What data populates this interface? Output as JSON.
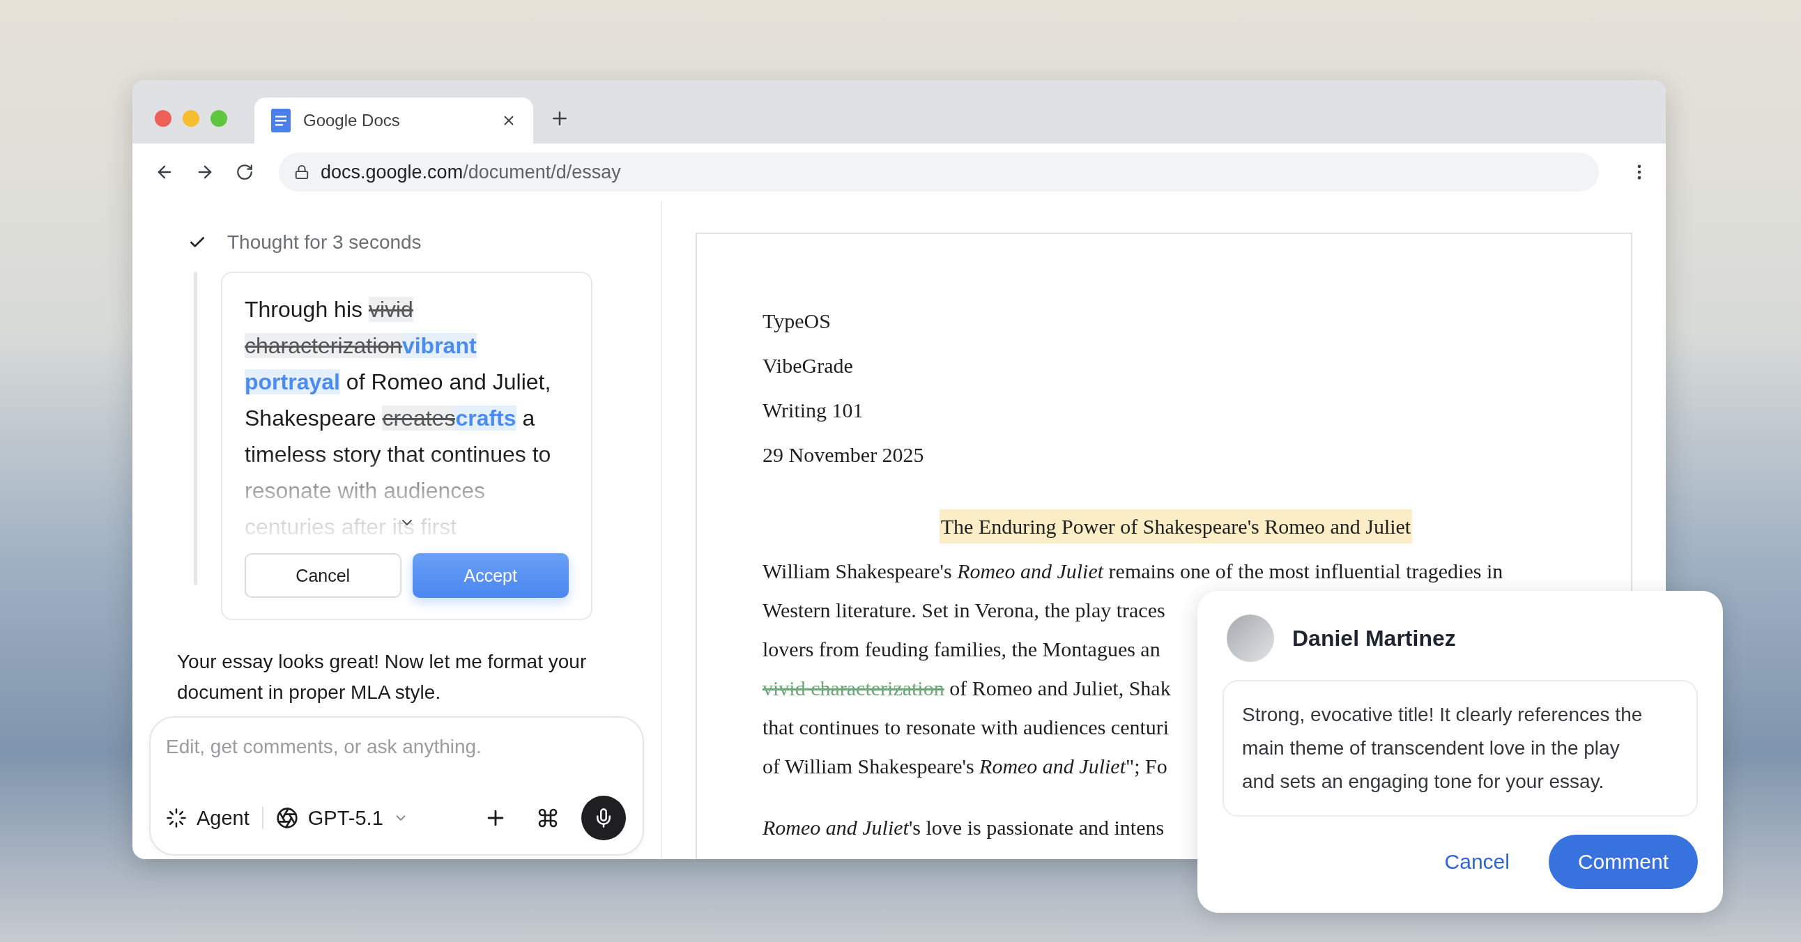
{
  "browser": {
    "tab": {
      "title": "Google Docs"
    },
    "address": {
      "host": "docs.google.com",
      "path": "/document/d/essay"
    }
  },
  "assistant": {
    "thought": "Thought for 3 seconds",
    "suggestion": {
      "segments": [
        {
          "kind": "plain",
          "text": "Through his "
        },
        {
          "kind": "deleted",
          "text": "vivid characterization"
        },
        {
          "kind": "inserted",
          "text": "vibrant portrayal"
        },
        {
          "kind": "plain",
          "text": " of Romeo and Juliet, Shakespeare "
        },
        {
          "kind": "deleted",
          "text": "creates"
        },
        {
          "kind": "inserted",
          "text": "crafts"
        },
        {
          "kind": "plain",
          "text": " a timeless story that continues to resonate with audiences centuries after its first"
        }
      ],
      "buttons": [
        {
          "kind": "secondary",
          "label": "Cancel"
        },
        {
          "kind": "primary",
          "label": "Accept"
        }
      ]
    },
    "message": "Your essay looks great! Now let me format your document in proper MLA style.",
    "composer": {
      "placeholder": "Edit, get comments, or ask anything.",
      "mode": "Agent",
      "model": "GPT-5.1"
    }
  },
  "document": {
    "header_lines": [
      "TypeOS",
      "VibeGrade",
      "Writing 101",
      "29 November 2025"
    ],
    "title": {
      "text": "The Enduring Power of Shakespeare's Romeo and Juliet",
      "highlighted": true
    },
    "paragraphs": [
      {
        "lines": [
          {
            "segments": [
              {
                "kind": "plain",
                "text": "William Shakespeare's *Romeo and Juliet* remains one of the most influential tragedies in"
              }
            ]
          },
          {
            "segments": [
              {
                "kind": "plain",
                "text": "Western literature. Set in Verona, the play traces"
              }
            ]
          },
          {
            "segments": [
              {
                "kind": "plain",
                "text": "lovers from feuding families, the Montagues an"
              }
            ]
          },
          {
            "segments": [
              {
                "kind": "deleted",
                "text": "vivid characterization"
              },
              {
                "kind": "plain",
                "text": " of Romeo and Juliet, Shak"
              }
            ]
          },
          {
            "segments": [
              {
                "kind": "plain",
                "text": "that continues to resonate with audiences centuri"
              }
            ]
          },
          {
            "segments": [
              {
                "kind": "plain",
                "text": "of William Shakespeare's *Romeo and Juliet*\"; Fo"
              }
            ]
          }
        ]
      },
      {
        "lines": [
          {
            "segments": [
              {
                "kind": "plain",
                "text": "*Romeo and Juliet*'s love is passionate and intens"
              }
            ]
          }
        ]
      }
    ]
  },
  "comment": {
    "author": "Daniel Martinez",
    "text": "Strong, evocative title! It clearly references the main theme of transcendent love in the play and sets an engaging tone for your essay.",
    "buttons": [
      {
        "kind": "secondary",
        "label": "Cancel"
      },
      {
        "kind": "primary",
        "label": "Comment"
      }
    ]
  }
}
